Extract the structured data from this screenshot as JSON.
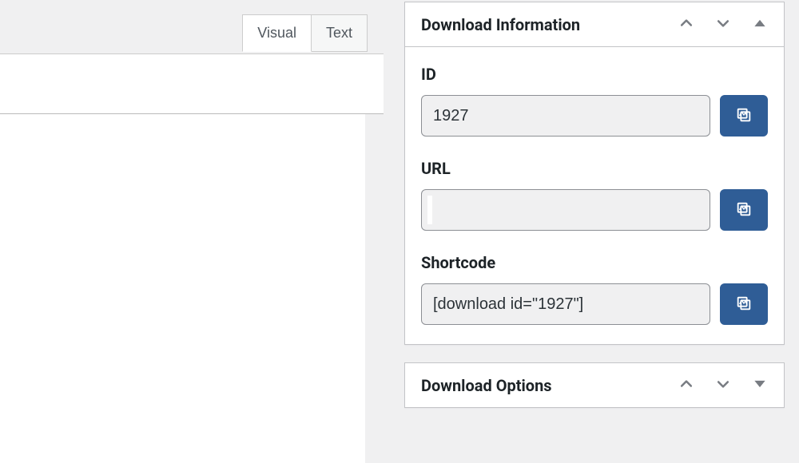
{
  "editor": {
    "tabs": {
      "visual": "Visual",
      "text": "Text"
    }
  },
  "sidebar": {
    "download_info": {
      "title": "Download Information",
      "fields": {
        "id": {
          "label": "ID",
          "value": "1927"
        },
        "url": {
          "label": "URL",
          "value": ""
        },
        "shortcode": {
          "label": "Shortcode",
          "value": "[download id=\"1927\"]"
        }
      }
    },
    "download_options": {
      "title": "Download Options"
    }
  }
}
